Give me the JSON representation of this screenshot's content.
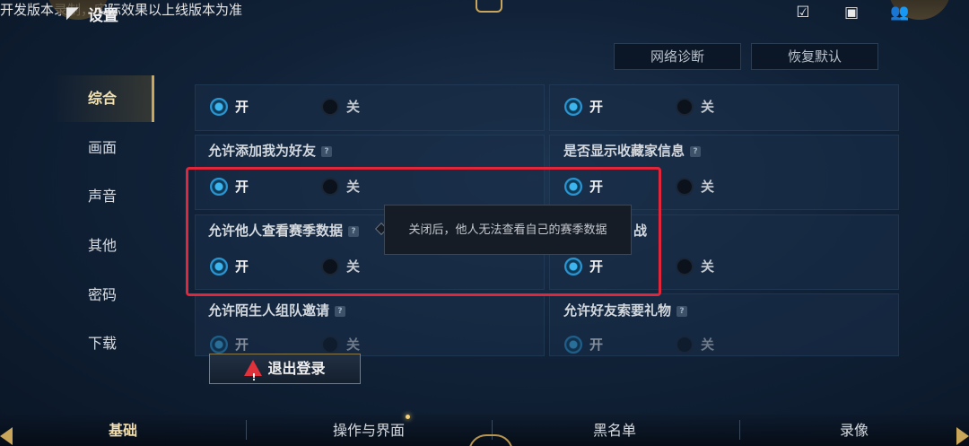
{
  "header": {
    "title": "设置",
    "back_icon": "back-arrow-icon",
    "icons": [
      "clipboard-check-icon",
      "chat-icon",
      "friends-icon"
    ]
  },
  "top_buttons": {
    "network": "网络诊断",
    "restore": "恢复默认"
  },
  "notice": "开发版本录制，实际效果以上线版本为准",
  "nav": {
    "items": [
      {
        "label": "综合",
        "active": true
      },
      {
        "label": "画面",
        "active": false
      },
      {
        "label": "声音",
        "active": false
      },
      {
        "label": "其他",
        "active": false
      },
      {
        "label": "密码",
        "active": false
      },
      {
        "label": "下载",
        "active": false
      }
    ]
  },
  "radio": {
    "on": "开",
    "off": "关"
  },
  "settings": {
    "row1_left": {
      "label": "",
      "value": "开"
    },
    "row1_right": {
      "label": "",
      "value": "开"
    },
    "row2_left": {
      "label": "允许添加我为好友",
      "value": "开"
    },
    "row2_right": {
      "label": "是否显示收藏家信息",
      "value": "开"
    },
    "row3_left": {
      "label": "允许他人查看赛季数据",
      "value": "开"
    },
    "row3_right": {
      "label": "战",
      "value": "开"
    },
    "row4_left": {
      "label": "允许陌生人组队邀请",
      "value": "开"
    },
    "row4_right": {
      "label": "允许好友索要礼物",
      "value": "开"
    }
  },
  "tooltip": "关闭后，他人无法查看自己的赛季数据",
  "logout": "退出登录",
  "bottom_tabs": [
    {
      "label": "基础",
      "active": true
    },
    {
      "label": "操作与界面",
      "active": false
    },
    {
      "label": "黑名单",
      "active": false
    },
    {
      "label": "录像",
      "active": false
    }
  ],
  "colors": {
    "accent_gold": "#c9a65a",
    "radio_on": "#2a95d0",
    "highlight": "#e0263a",
    "warning": "#e0323a"
  }
}
